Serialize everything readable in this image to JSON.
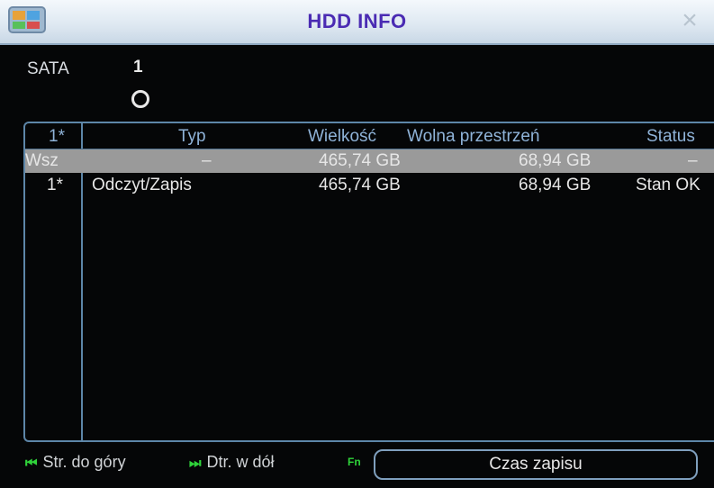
{
  "window": {
    "title": "HDD INFO"
  },
  "sata": {
    "label": "SATA",
    "number": "1"
  },
  "table": {
    "headers": [
      "1*",
      "Typ",
      "Wielkość",
      "Wolna przestrzeń",
      "Status"
    ],
    "rows": [
      [
        "Wsz",
        "–",
        "465,74 GB",
        "68,94 GB",
        "–"
      ],
      [
        "1*",
        "Odczyt/Zapis",
        "465,74 GB",
        "68,94 GB",
        "Stan OK"
      ]
    ]
  },
  "footer": {
    "page_up": "Str. do góry",
    "page_down": "Dtr. w dół",
    "record_time_button": "Czas zapisu",
    "fn_label": "Fn"
  },
  "colors": {
    "title": "#4a2bb3",
    "header_text": "#8fb3d8",
    "selected_row": "#9a9a9a",
    "frame": "#5d86a8",
    "fn_icon": "#2fd33a"
  }
}
